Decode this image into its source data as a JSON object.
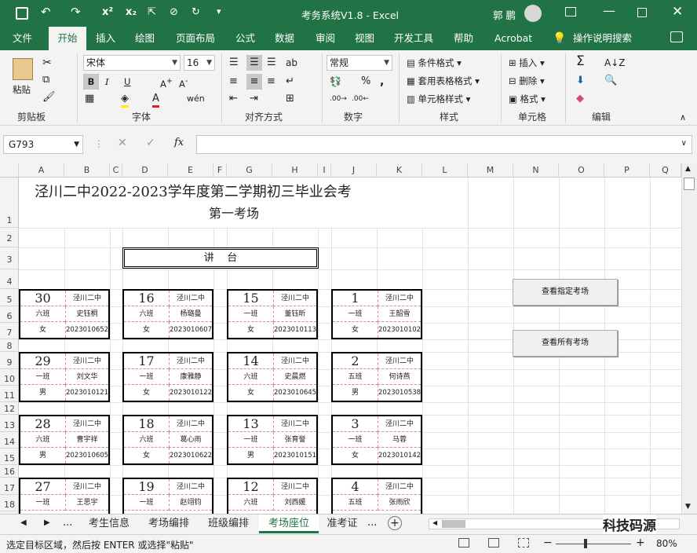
{
  "window": {
    "title": "考务系统V1.8  -  Excel",
    "user": "郭 鹏"
  },
  "ribbon_tabs": [
    "文件",
    "开始",
    "插入",
    "绘图",
    "页面布局",
    "公式",
    "数据",
    "审阅",
    "视图",
    "开发工具",
    "帮助",
    "Acrobat",
    "操作说明搜索"
  ],
  "ribbon": {
    "paste": "粘贴",
    "clipboard": "剪贴板",
    "font_name": "宋体",
    "font_size": "16",
    "font": "字体",
    "alignment": "对齐方式",
    "number_format": "常规",
    "number": "数字",
    "cond_format": "条件格式",
    "table_format": "套用表格格式",
    "cell_style": "单元格样式",
    "styles": "样式",
    "insert": "插入",
    "delete": "删除",
    "format": "格式",
    "cells": "单元格",
    "editing": "编辑"
  },
  "formula_bar": {
    "name_box": "G793",
    "fx": "fx",
    "formula": ""
  },
  "columns": [
    "A",
    "B",
    "C",
    "D",
    "E",
    "F",
    "G",
    "H",
    "I",
    "J",
    "K",
    "L",
    "M",
    "N",
    "O",
    "P",
    "Q"
  ],
  "rows": [
    "1",
    "2",
    "3",
    "4",
    "5",
    "6",
    "7",
    "8",
    "9",
    "10",
    "11",
    "12",
    "13",
    "14",
    "15",
    "16",
    "17",
    "18"
  ],
  "sheet": {
    "title_line1": "泾川二中2022-2023学年度第二学期初三毕业会考",
    "title_line2": "第一考场",
    "podium": "讲    台"
  },
  "seats": [
    [
      {
        "num": "30",
        "school": "泾川二中",
        "cls": "六班",
        "name": "史钰桐",
        "gender": "女",
        "sid": "2023010652"
      },
      {
        "num": "16",
        "school": "泾川二中",
        "cls": "六班",
        "name": "杨璐曼",
        "gender": "女",
        "sid": "2023010607"
      },
      {
        "num": "15",
        "school": "泾川二中",
        "cls": "一班",
        "name": "董钰昕",
        "gender": "女",
        "sid": "2023010113"
      },
      {
        "num": "1",
        "school": "泾川二中",
        "cls": "一班",
        "name": "王韶雪",
        "gender": "女",
        "sid": "2023010102"
      }
    ],
    [
      {
        "num": "29",
        "school": "泾川二中",
        "cls": "一班",
        "name": "刘文华",
        "gender": "男",
        "sid": "2023010121"
      },
      {
        "num": "17",
        "school": "泾川二中",
        "cls": "一班",
        "name": "康雅静",
        "gender": "女",
        "sid": "2023010122"
      },
      {
        "num": "14",
        "school": "泾川二中",
        "cls": "六班",
        "name": "史晨燃",
        "gender": "女",
        "sid": "2023010645"
      },
      {
        "num": "2",
        "school": "泾川二中",
        "cls": "五班",
        "name": "何诗燕",
        "gender": "男",
        "sid": "2023010538"
      }
    ],
    [
      {
        "num": "28",
        "school": "泾川二中",
        "cls": "六班",
        "name": "曹宇祥",
        "gender": "男",
        "sid": "2023010605"
      },
      {
        "num": "18",
        "school": "泾川二中",
        "cls": "六班",
        "name": "葛心雨",
        "gender": "女",
        "sid": "2023010622"
      },
      {
        "num": "13",
        "school": "泾川二中",
        "cls": "一班",
        "name": "张育誉",
        "gender": "男",
        "sid": "2023010151"
      },
      {
        "num": "3",
        "school": "泾川二中",
        "cls": "一班",
        "name": "马蓉",
        "gender": "女",
        "sid": "2023010142"
      }
    ],
    [
      {
        "num": "27",
        "school": "泾川二中",
        "cls": "一班",
        "name": "王思宇",
        "gender": "",
        "sid": ""
      },
      {
        "num": "19",
        "school": "泾川二中",
        "cls": "一班",
        "name": "赵翊钧",
        "gender": "",
        "sid": ""
      },
      {
        "num": "12",
        "school": "泾川二中",
        "cls": "六班",
        "name": "刘西媛",
        "gender": "",
        "sid": ""
      },
      {
        "num": "4",
        "school": "泾川二中",
        "cls": "五班",
        "name": "张雨欣",
        "gender": "",
        "sid": ""
      }
    ]
  ],
  "buttons": {
    "view_specific": "查看指定考场",
    "view_all": "查看所有考场"
  },
  "sheet_tabs": [
    "考生信息",
    "考场编排",
    "班级编排",
    "考场座位",
    "准考证"
  ],
  "status": {
    "message": "选定目标区域，然后按 ENTER 或选择\"粘贴\"",
    "zoom": "80%"
  },
  "watermark": "科技码源"
}
